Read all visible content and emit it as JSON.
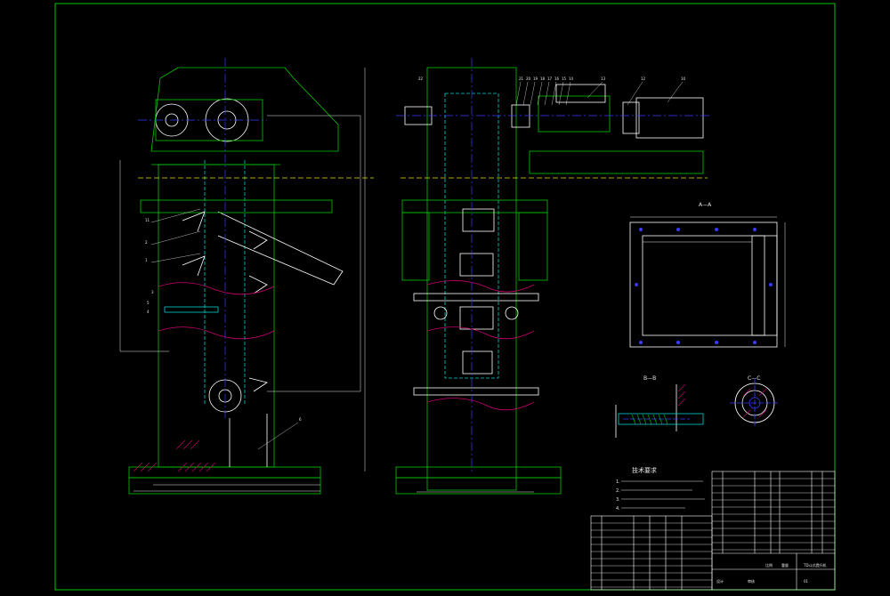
{
  "colors": {
    "background": "#000000",
    "frame": "#00c800",
    "outline": "#ffffff",
    "centerline": "#3a3aff",
    "hatch": "#c8006e",
    "hidden": "#e6e600",
    "accent_cyan": "#00d0d0",
    "dimension": "#e6e6e6"
  },
  "views": {
    "section_a": "A—A",
    "section_b": "B—B",
    "section_c": "C—C"
  },
  "tech": {
    "heading": "技术要求",
    "items": [
      "1.",
      "2.",
      "3.",
      "4."
    ]
  },
  "callouts": {
    "left": [
      "11",
      "2",
      "1",
      "3",
      "5",
      "4",
      "6"
    ],
    "top": [
      "22",
      "21",
      "20",
      "19",
      "18",
      "17",
      "16",
      "15",
      "14"
    ],
    "right": [
      "13",
      "12",
      "10"
    ]
  },
  "title_block": {
    "drawing_name": "TD斗式提升机",
    "sheet": "01",
    "scale_label": "比例",
    "weight_label": "重量",
    "design_label": "设计",
    "check_label": "审核"
  }
}
